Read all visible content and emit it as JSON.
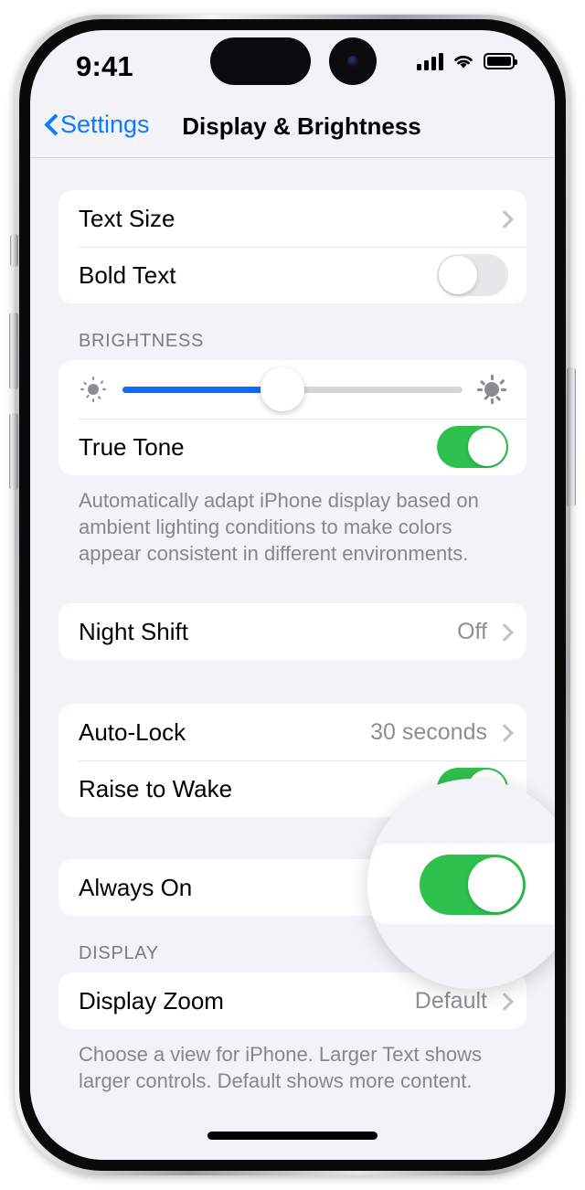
{
  "status_bar": {
    "time": "9:41",
    "signal_icon": "cellular-bars-icon",
    "wifi_icon": "wifi-icon",
    "battery_icon": "battery-full-icon"
  },
  "nav": {
    "back_label": "Settings",
    "back_icon": "chevron-left-icon",
    "title": "Display & Brightness"
  },
  "groups": {
    "text": {
      "rows": [
        {
          "label": "Text Size",
          "type": "disclosure",
          "value": ""
        },
        {
          "label": "Bold Text",
          "type": "toggle",
          "state": "off"
        }
      ]
    },
    "brightness": {
      "header": "BRIGHTNESS",
      "slider": {
        "name": "brightness-slider",
        "value_percent": 47,
        "min_icon": "sun-small-icon",
        "max_icon": "sun-large-icon",
        "fill_color": "#0a6dfb",
        "track_color": "#d6d6da"
      },
      "true_tone": {
        "label": "True Tone",
        "state": "on"
      },
      "footer": "Automatically adapt iPhone display based on ambient lighting conditions to make colors appear consistent in different environments."
    },
    "night_shift": {
      "rows": [
        {
          "label": "Night Shift",
          "value": "Off",
          "type": "disclosure"
        }
      ]
    },
    "lock": {
      "rows": [
        {
          "label": "Auto-Lock",
          "value": "30 seconds",
          "type": "disclosure"
        },
        {
          "label": "Raise to Wake",
          "type": "toggle",
          "state": "on"
        }
      ]
    },
    "always_on": {
      "rows": [
        {
          "label": "Always On",
          "type": "toggle",
          "state": "on"
        }
      ]
    },
    "display": {
      "header": "DISPLAY",
      "rows": [
        {
          "label": "Display Zoom",
          "value": "Default",
          "type": "disclosure"
        }
      ],
      "footer": "Choose a view for iPhone. Larger Text shows larger controls. Default shows more content."
    }
  },
  "magnifier": {
    "name": "magnified-always-on-toggle",
    "toggle_state": "on",
    "toggle_color": "#2fc14e"
  },
  "colors": {
    "accent_blue": "#0a7cff",
    "toggle_green": "#2fc14e",
    "toggle_off_gray": "#e7e7ea",
    "page_background": "#f2f2f7",
    "secondary_text": "#8e8e93"
  },
  "watermark": {
    "text": "",
    "sub": ""
  }
}
